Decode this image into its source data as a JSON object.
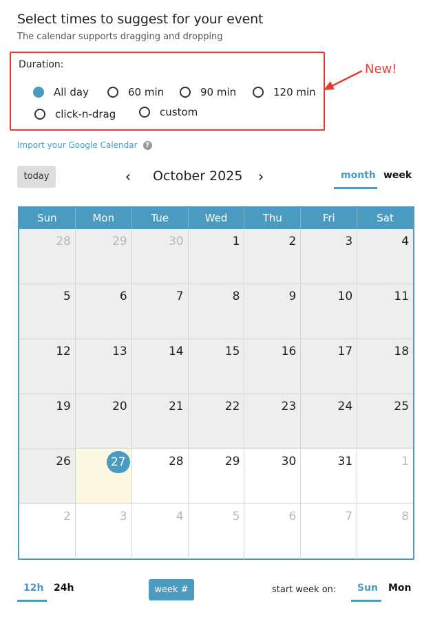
{
  "header": {
    "title": "Select times to suggest for your event",
    "subtitle": "The calendar supports dragging and dropping"
  },
  "duration": {
    "label": "Duration:",
    "options": [
      {
        "label": "All day",
        "checked": true
      },
      {
        "label": "60 min",
        "checked": false
      },
      {
        "label": "90 min",
        "checked": false
      },
      {
        "label": "120 min",
        "checked": false
      },
      {
        "label": "click-n-drag",
        "checked": false
      },
      {
        "label": "custom",
        "checked": false
      }
    ],
    "callout": "New!"
  },
  "import": {
    "link": "Import your Google Calendar",
    "help_icon": "?"
  },
  "toolbar": {
    "today": "today",
    "prev_icon": "‹",
    "next_icon": "›",
    "month_title": "October 2025",
    "view_month": "month",
    "view_week": "week",
    "active_view": "month"
  },
  "calendar": {
    "weekdays": [
      "Sun",
      "Mon",
      "Tue",
      "Wed",
      "Thu",
      "Fri",
      "Sat"
    ],
    "weeks": [
      [
        "28",
        "29",
        "30",
        "1",
        "2",
        "3",
        "4"
      ],
      [
        "5",
        "6",
        "7",
        "8",
        "9",
        "10",
        "11"
      ],
      [
        "12",
        "13",
        "14",
        "15",
        "16",
        "17",
        "18"
      ],
      [
        "19",
        "20",
        "21",
        "22",
        "23",
        "24",
        "25"
      ],
      [
        "26",
        "27",
        "28",
        "29",
        "30",
        "31",
        "1"
      ],
      [
        "2",
        "3",
        "4",
        "5",
        "6",
        "7",
        "8"
      ]
    ],
    "today": "27"
  },
  "footer": {
    "time_12h": "12h",
    "time_24h": "24h",
    "active_time": "12h",
    "week_number": "week #",
    "start_week_label": "start week on:",
    "start_sun": "Sun",
    "start_mon": "Mon",
    "active_start": "Sun"
  },
  "colors": {
    "accent": "#4a9bbf",
    "callout": "#e53b34",
    "past_bg": "#eeeeee",
    "today_bg": "#fdf8e1"
  }
}
